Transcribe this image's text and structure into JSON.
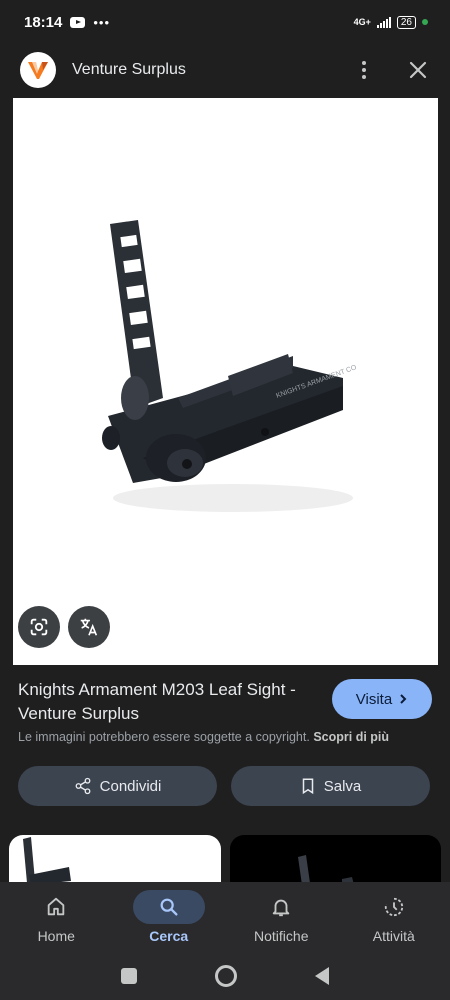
{
  "status_bar": {
    "time": "18:14",
    "network": "4G+",
    "battery": "26"
  },
  "header": {
    "site_name": "Venture Surplus",
    "icons": [
      "venture-surplus-logo",
      "more-vert-icon",
      "close-icon"
    ]
  },
  "image_buttons": {
    "icons": [
      "google-lens-icon",
      "translate-icon"
    ]
  },
  "result": {
    "title": "Knights Armament M203 Leaf Sight - Venture Surplus",
    "visit_label": "Visita",
    "copyright_text": "Le immagini potrebbero essere soggette a copyright.",
    "learn_more": "Scopri di più"
  },
  "actions": {
    "share_label": "Condividi",
    "save_label": "Salva"
  },
  "bottom_nav": {
    "items": [
      {
        "label": "Home",
        "icon": "home-icon",
        "active": false
      },
      {
        "label": "Cerca",
        "icon": "search-icon",
        "active": true
      },
      {
        "label": "Notifiche",
        "icon": "bell-icon",
        "active": false
      },
      {
        "label": "Attività",
        "icon": "history-icon",
        "active": false
      }
    ]
  },
  "colors": {
    "background": "#1f1f1f",
    "accent": "#8ab4f8",
    "active_nav": "#a8c7fa",
    "button_bg": "#3c4450"
  }
}
